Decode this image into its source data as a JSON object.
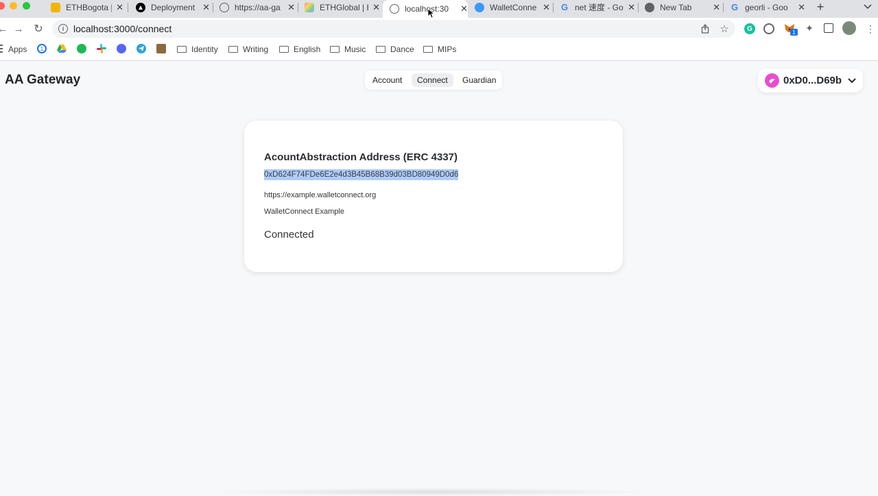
{
  "browser": {
    "tabs": [
      {
        "title": "ETHBogota |",
        "icon": "slides-icon",
        "color": "#f4b400"
      },
      {
        "title": "Deployment",
        "icon": "vercel-icon",
        "color": "#000000"
      },
      {
        "title": "https://aa-ga",
        "icon": "globe-icon",
        "color": "#5f6368"
      },
      {
        "title": "ETHGlobal | E",
        "icon": "ethglobal-icon",
        "color": "#e8eaed"
      },
      {
        "title": "localhost:30",
        "icon": "globe-icon",
        "color": "#5f6368"
      },
      {
        "title": "WalletConne",
        "icon": "walletconnect-icon",
        "color": "#3b99fc"
      },
      {
        "title": "net 速度 - Go",
        "icon": "google-icon",
        "color": "#4285f4"
      },
      {
        "title": "New Tab",
        "icon": "chrome-icon",
        "color": "#5f6368"
      },
      {
        "title": "georli - Goo",
        "icon": "google-icon",
        "color": "#4285f4"
      }
    ],
    "active_tab": 4,
    "address": "localhost:3000/connect",
    "bookmarks": {
      "apps": "Apps",
      "folders": [
        "Identity",
        "Writing",
        "English",
        "Music",
        "Dance",
        "MIPs"
      ]
    },
    "extension_badge": "1"
  },
  "app": {
    "brand": "AA Gateway",
    "nav": [
      "Account",
      "Connect",
      "Guardian"
    ],
    "active_nav": "Connect",
    "account_label": "0xD0...D69b",
    "card": {
      "title": "AcountAbstraction Address (ERC 4337)",
      "address": "0xD624F74FDe6E2e4d3B45B68B39d03BD80949D0d6",
      "url": "https://example.walletconnect.org",
      "name": "WalletConnect Example",
      "status": "Connected"
    }
  },
  "colors": {
    "selection": "#aecbfa",
    "avatar": "#e84dd0",
    "page_bg": "#f7f8fa"
  }
}
